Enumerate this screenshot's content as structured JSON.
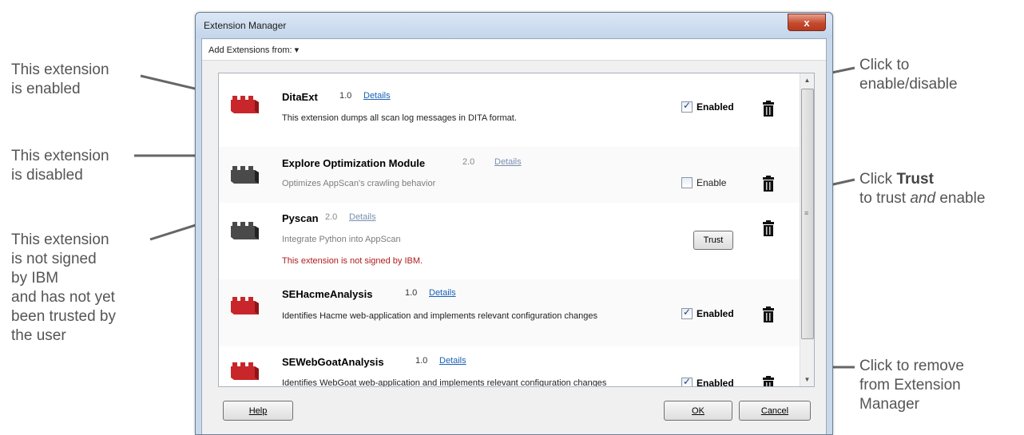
{
  "callouts": {
    "enabled": [
      "This extension",
      "is enabled"
    ],
    "disabled": [
      "This extension",
      "is disabled"
    ],
    "unsigned": [
      "This extension",
      "is not signed",
      "by IBM",
      "and has not yet",
      "been trusted by",
      "the user"
    ],
    "toggle": [
      "Click to",
      "enable/disable"
    ],
    "trust_prefix": "Click ",
    "trust_bold": "Trust",
    "trust_line2_a": "to trust ",
    "trust_line2_em": "and",
    "trust_line2_b": " enable",
    "remove": [
      "Click to remove",
      "from Extension",
      "Manager"
    ]
  },
  "window": {
    "title": "Extension Manager",
    "close_glyph": "x",
    "add_label": "Add Extensions from: ▾"
  },
  "extensions": [
    {
      "name": "DitaExt",
      "version": "1.0",
      "details": "Details",
      "description": "This extension dumps all scan log messages in DITA format.",
      "status": "Enabled",
      "checked": true
    },
    {
      "name": "Explore Optimization Module",
      "version": "2.0",
      "details": "Details",
      "description": "Optimizes AppScan's crawling behavior",
      "status": "Enable",
      "checked": false
    },
    {
      "name": "Pyscan",
      "version": "2.0",
      "details": "Details",
      "description": "Integrate Python into AppScan",
      "warning": "This extension is not signed by IBM.",
      "action": "Trust"
    },
    {
      "name": "SEHacmeAnalysis",
      "version": "1.0",
      "details": "Details",
      "description": "Identifies Hacme web-application and implements relevant configuration changes",
      "status": "Enabled",
      "checked": true
    },
    {
      "name": "SEWebGoatAnalysis",
      "version": "1.0",
      "details": "Details",
      "description": "Identifies WebGoat web-application and implements relevant configuration changes",
      "status": "Enabled",
      "checked": true
    }
  ],
  "buttons": {
    "help": "Help",
    "ok": "OK",
    "cancel": "Cancel"
  },
  "colors": {
    "enabled_icon": "#c8262a",
    "disabled_icon": "#4a4a4a",
    "link": "#1a5fb4",
    "warning": "#b01c1c"
  }
}
